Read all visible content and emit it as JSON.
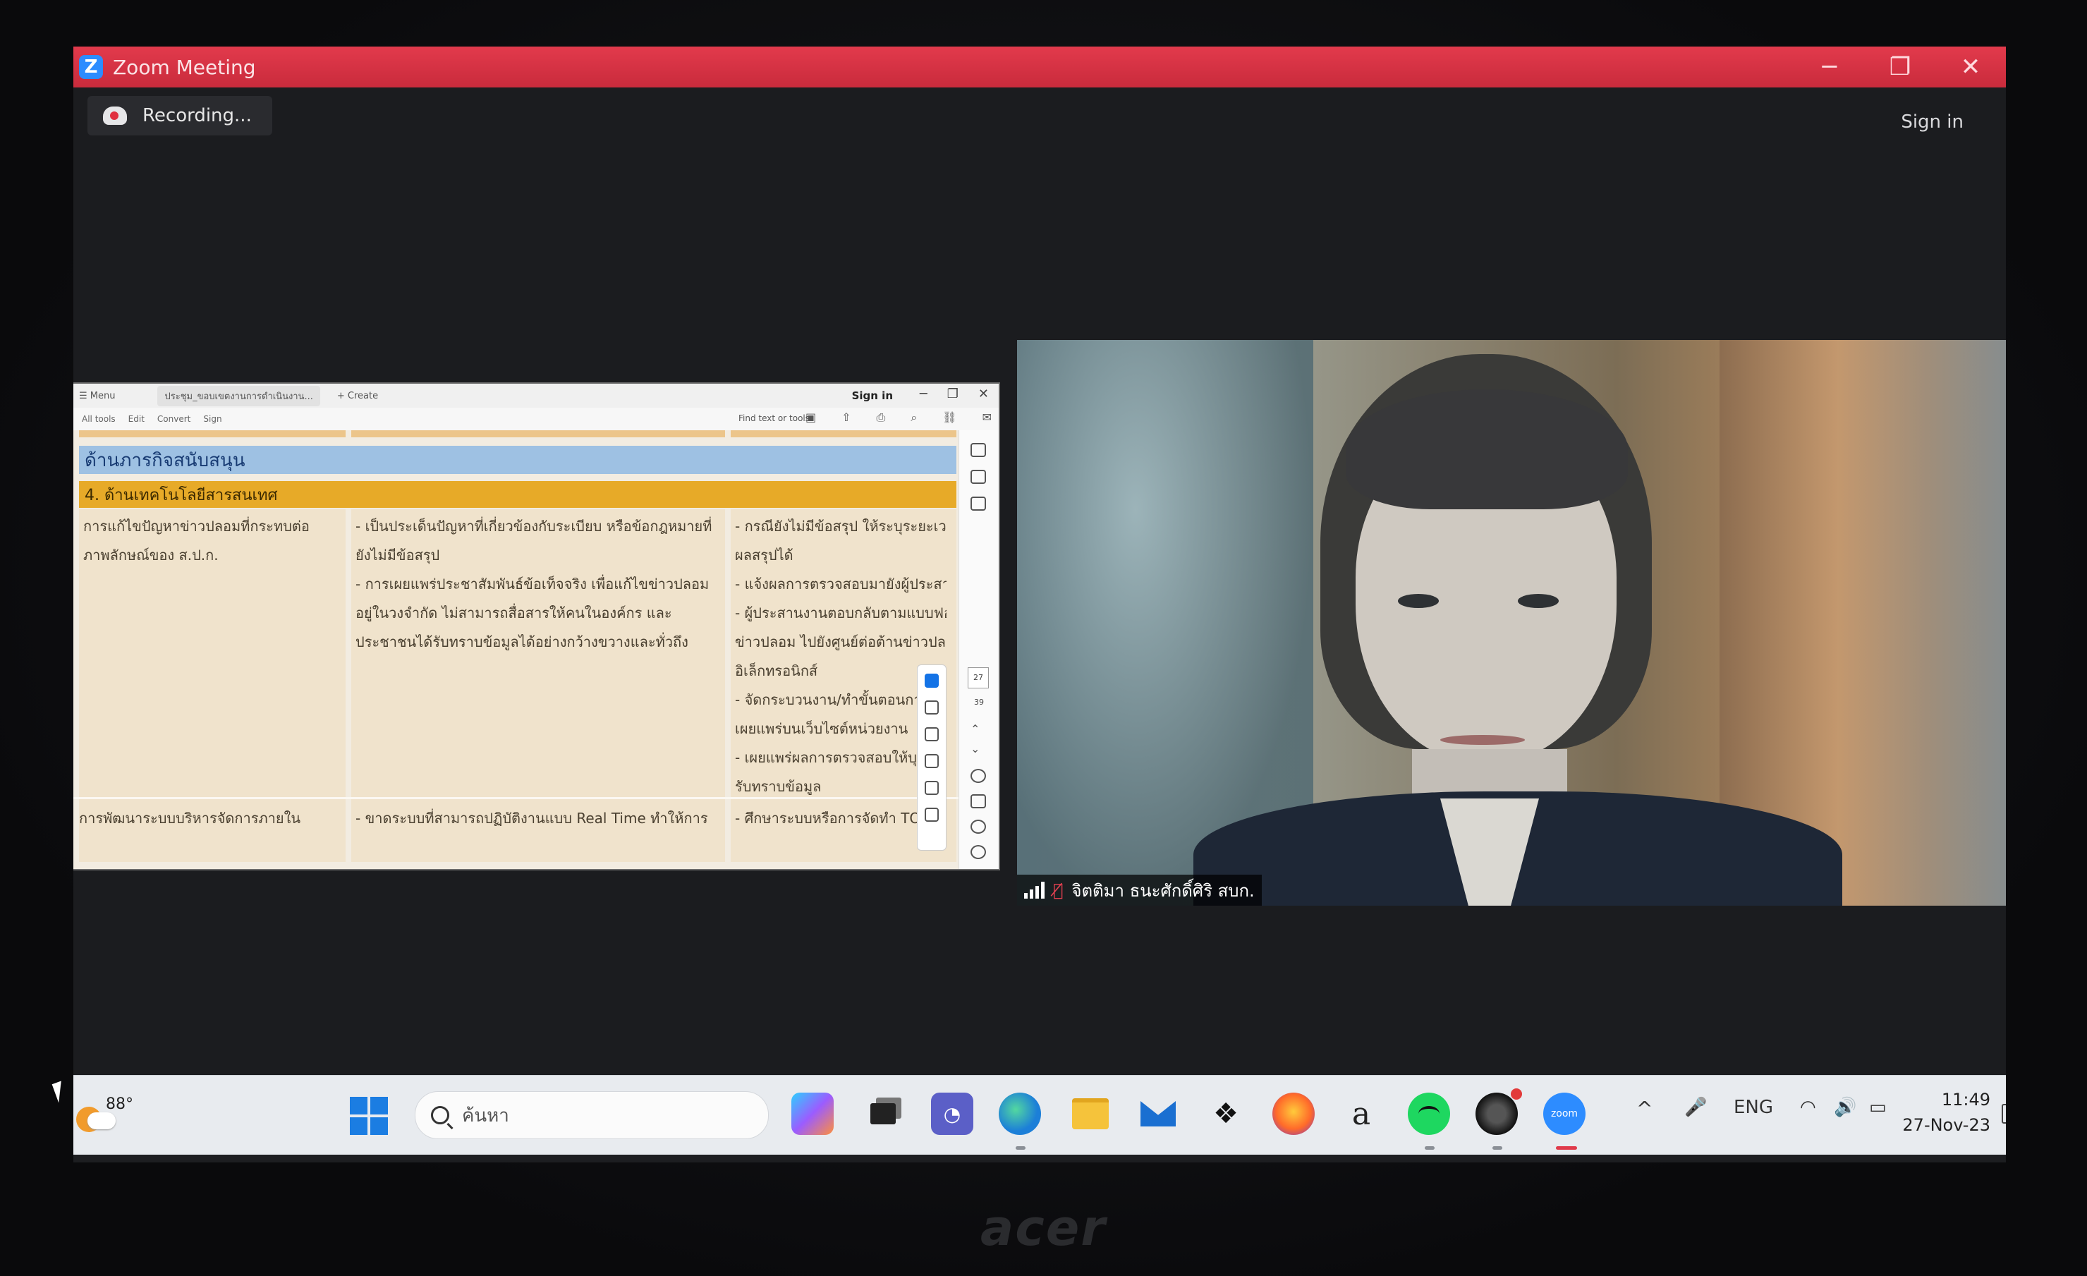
{
  "zoom": {
    "title": "Zoom Meeting",
    "logo": "Z",
    "recording": "Recording...",
    "sign_in": "Sign in",
    "controls": [
      "─",
      "❐",
      "✕"
    ]
  },
  "shared_screen": {
    "acrobat": {
      "tab_home": "☰ Menu",
      "tab_doc": "ประชุม_ขอบเขตงานการดำเนินงาน...",
      "tab_create": "+ Create",
      "sign_in": "Sign in",
      "menu": [
        "All tools",
        "Edit",
        "Convert",
        "Sign"
      ],
      "find": "Find text or tools",
      "page_current": "27",
      "page_total": "39"
    },
    "section_title": "ด้านภารกิจสนับสนุน",
    "sub_title": "4. ด้านเทคโนโลยีสารสนเทศ",
    "row1": {
      "col1": [
        "การแก้ไขปัญหาข่าวปลอมที่กระทบต่อ",
        "ภาพลักษณ์ของ ส.ป.ก."
      ],
      "col2": [
        "- เป็นประเด็นปัญหาที่เกี่ยวข้องกับระเบียบ หรือข้อกฎหมายที่",
        "ยังไม่มีข้อสรุป",
        "- การเผยแพร่ประชาสัมพันธ์ข้อเท็จจริง เพื่อแก้ไขข่าวปลอม",
        "อยู่ในวงจำกัด ไม่สามารถสื่อสารให้คนในองค์กร และ",
        "ประชาชนได้รับทราบข้อมูลได้อย่างกว้างขวางและทั่วถึง"
      ],
      "col3": [
        "- กรณียังไม่มีข้อสรุป ให้ระบุระยะเวลาที่คาด",
        "ผลสรุปได้",
        "- แจ้งผลการตรวจสอบมายังผู้ประสานงาน",
        "- ผู้ประสานงานตอบกลับตามแบบฟอร์มการ",
        "ข่าวปลอม ไปยังศูนย์ต่อต้านข่าวปลอม",
        "อิเล็กทรอนิกส์",
        "- จัดกระบวนงาน/ทำขั้นตอนการตอบ",
        "เผยแพร่บนเว็บไซต์หน่วยงาน",
        "- เผยแพร่ผลการตรวจสอบให้บุคลากร",
        "รับทราบข้อมูล"
      ]
    },
    "row2": {
      "col1": "การพัฒนาระบบบริหารจัดการภายใน",
      "col2": "- ขาดระบบที่สามารถปฏิบัติงานแบบ Real Time ทำให้การ",
      "col3": "- ศึกษาระบบหรือการจัดทำ TOR ขอ"
    }
  },
  "video": {
    "participant_name": "จิตติมา ธนะศักดิ์ศิริ สบก."
  },
  "taskbar": {
    "temperature": "88°",
    "search_placeholder": "ค้นหา",
    "language": "ENG",
    "time": "11:49",
    "date": "27-Nov-23",
    "apps": [
      "copilot",
      "task-view",
      "teams",
      "edge",
      "file-explorer",
      "mail",
      "dropbox",
      "firefox",
      "amazon",
      "spotify",
      "obs",
      "zoom"
    ],
    "amazon_label": "a",
    "zoom_label": "zoom",
    "tray_chevron": "^",
    "mic": "🎤",
    "wifi": "◠",
    "volume": "🔊",
    "battery": "▭"
  },
  "device": {
    "brand": "acer"
  }
}
